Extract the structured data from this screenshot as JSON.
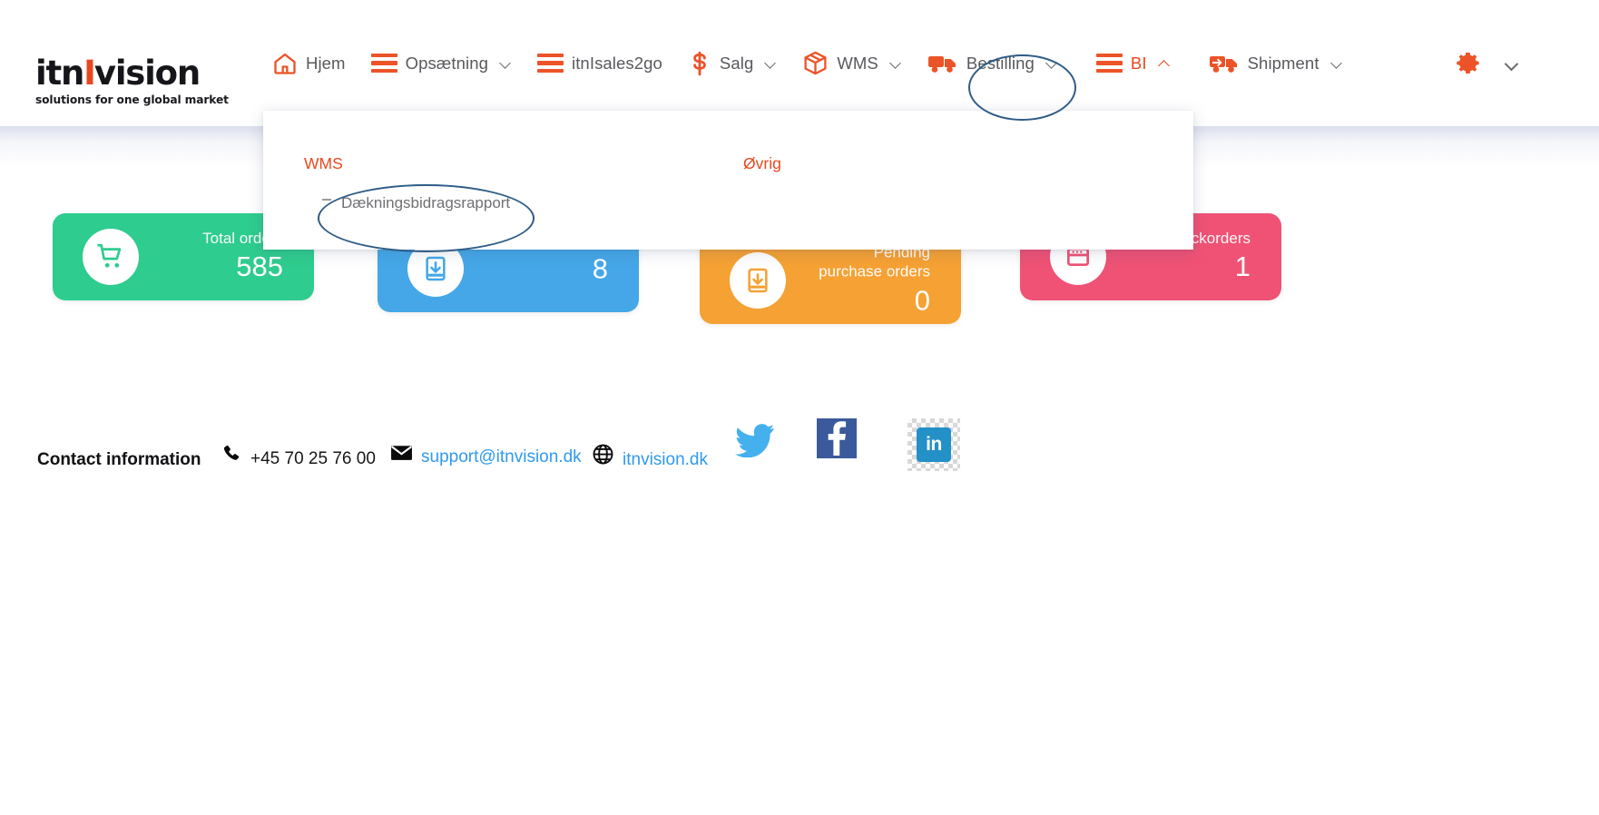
{
  "brand": {
    "name_part1": "itn",
    "name_bar": "I",
    "name_part2": "vision",
    "tagline": "solutions for one global market",
    "accent_color": "#e8481e"
  },
  "nav": {
    "items": [
      {
        "label": "Hjem",
        "icon": "home-icon",
        "caret": false,
        "active": false
      },
      {
        "label": "Opsætning",
        "icon": "hamburger-icon",
        "caret": true,
        "active": false
      },
      {
        "label": "itnIsales2go",
        "icon": "hamburger-icon",
        "caret": false,
        "active": false
      },
      {
        "label": "Salg",
        "icon": "dollar-icon",
        "caret": true,
        "active": false
      },
      {
        "label": "WMS",
        "icon": "box-icon",
        "caret": true,
        "active": false
      },
      {
        "label": "Bestilling",
        "icon": "truck-icon",
        "caret": true,
        "active": false
      },
      {
        "label": "BI",
        "icon": "hamburger-icon",
        "caret": true,
        "caret_dir": "up",
        "active": true
      },
      {
        "label": "Shipment",
        "icon": "truck-arrow-icon",
        "caret": true,
        "active": false
      }
    ],
    "settings": {
      "icon": "gear-icon",
      "caret": true
    }
  },
  "dropdown": {
    "open_for": "BI",
    "columns": [
      {
        "title": "WMS",
        "items": [
          {
            "label": "Dækningsbidragsrapport",
            "bullet": "-"
          }
        ]
      },
      {
        "title": "Øvrig",
        "items": []
      }
    ]
  },
  "cards": [
    {
      "label": "Total orders",
      "value": "585",
      "color": "#2ecc8e",
      "icon": "shopping-cart-icon"
    },
    {
      "label": "",
      "value": "8",
      "color": "#45a7e8",
      "icon": "inbox-download-icon"
    },
    {
      "label": "Pending purchase orders",
      "value": "0",
      "color": "#f5a134",
      "icon": "inbox-download-icon"
    },
    {
      "label": "Backorders",
      "value": "1",
      "color": "#ef5275",
      "icon": "window-icon"
    }
  ],
  "footer": {
    "title": "Contact information",
    "phone": "+45 70 25 76 00",
    "email": "support@itnvision.dk",
    "website": "itnvision.dk",
    "link_color": "#2f9aee",
    "social": [
      {
        "name": "twitter",
        "label": "Twitter"
      },
      {
        "name": "facebook",
        "label": "f"
      },
      {
        "name": "linkedin",
        "label": "in"
      }
    ]
  },
  "annotations": [
    {
      "name": "bi-menu-highlight",
      "shape": "ellipse",
      "color": "#2e5c86"
    },
    {
      "name": "report-link-highlight",
      "shape": "ellipse",
      "color": "#2e5c86"
    }
  ]
}
